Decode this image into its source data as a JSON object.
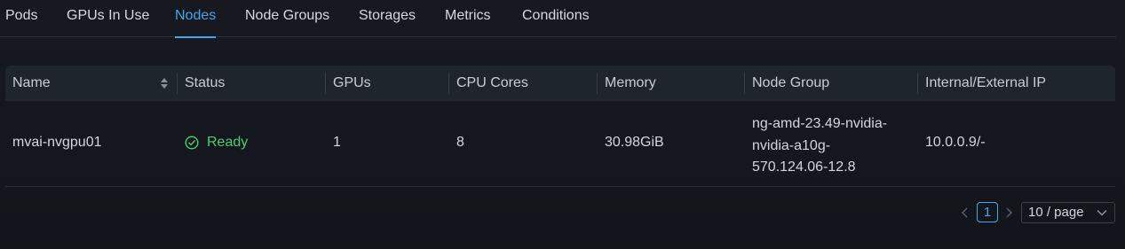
{
  "tabs": [
    {
      "label": "Pods",
      "active": false
    },
    {
      "label": "GPUs In Use",
      "active": false
    },
    {
      "label": "Nodes",
      "active": true
    },
    {
      "label": "Node Groups",
      "active": false
    },
    {
      "label": "Storages",
      "active": false
    },
    {
      "label": "Metrics",
      "active": false
    },
    {
      "label": "Conditions",
      "active": false
    }
  ],
  "table": {
    "columns": [
      "Name",
      "Status",
      "GPUs",
      "CPU Cores",
      "Memory",
      "Node Group",
      "Internal/External IP"
    ],
    "rows": [
      {
        "name": "mvai-nvgpu01",
        "status": "Ready",
        "gpus": "1",
        "cpu_cores": "8",
        "memory": "30.98GiB",
        "node_group_lines": [
          "ng-amd-23.49-nvidia-",
          "nvidia-a10g-",
          "570.124.06-12.8"
        ],
        "ip": "10.0.0.9/-"
      }
    ]
  },
  "pagination": {
    "current_page": "1",
    "page_size": "10 / page"
  },
  "colors": {
    "accent": "#4aa3e8",
    "status_ready": "#4fce6f",
    "background": "#14181e",
    "header_bg": "#1f252d"
  },
  "icons": {
    "sort": "sort-icon",
    "status_ready": "check-circle-icon",
    "prev": "chevron-left-icon",
    "next": "chevron-right-icon",
    "dropdown": "chevron-down-icon"
  }
}
